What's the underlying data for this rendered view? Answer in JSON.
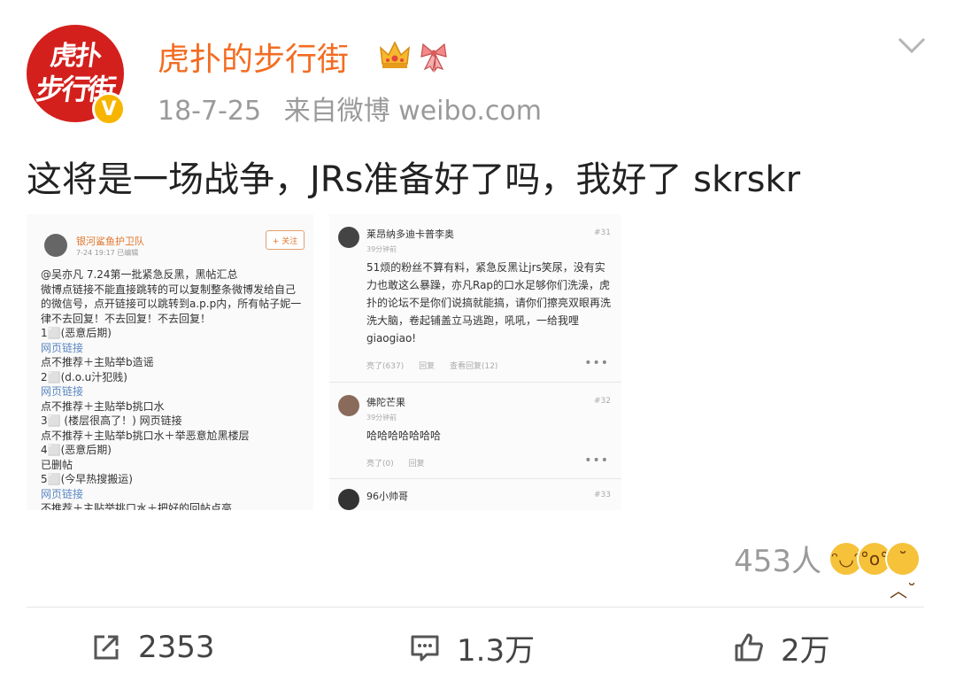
{
  "user": {
    "name": "虎扑的步行街",
    "avatar_line1": "虎扑",
    "avatar_line2": "步行街",
    "verified_label": "V",
    "icons": [
      "crown-icon",
      "ribbon-icon"
    ]
  },
  "post": {
    "date": "18-7-25",
    "source": "来自微博 weibo.com",
    "text": "这将是一场战争，JRs准备好了吗，我好了 skrskr"
  },
  "image1": {
    "user": "银河鲨鱼护卫队",
    "date": "7-24 19:17 已编辑",
    "follow": "+ 关注",
    "lines": [
      {
        "text": "@吴亦凡 7.24第一批紧急反黑，黑帖汇总",
        "link": false
      },
      {
        "text": "微博点链接不能直接跳转的可以复制整条微博发给自己",
        "link": false
      },
      {
        "text": "的微信号，点开链接可以跳转到a.p.p内，所有帖子妮一",
        "link": false
      },
      {
        "text": "律不去回复！不去回复！不去回复！",
        "link": false
      },
      {
        "text": "1⬜(恶意后期)",
        "link": false
      },
      {
        "text": "网页链接",
        "link": true
      },
      {
        "text": " 点不推荐＋主贴举b造谣",
        "link": false
      },
      {
        "text": "2⬜(d.o.u汁犯贱)",
        "link": false
      },
      {
        "text": "网页链接",
        "link": true
      },
      {
        "text": " 点不推荐＋主贴举b挑口水",
        "link": false
      },
      {
        "text": "3⬜ (楼层很高了！) 网页链接",
        "link": false
      },
      {
        "text": "点不推荐＋主贴举b挑口水＋举恶意尬黑楼层",
        "link": false
      },
      {
        "text": "4⬜(恶意后期)",
        "link": false
      },
      {
        "text": "已删帖",
        "link": false
      },
      {
        "text": "5⬜(今早热搜搬运)",
        "link": false
      },
      {
        "text": "网页链接",
        "link": true
      },
      {
        "text": "不推荐＋主贴举挑口水＋把好的回帖点亮",
        "link": false
      }
    ]
  },
  "image2": {
    "comments": [
      {
        "name": "莱昂纳多迪卡普李奥",
        "floor": "#31",
        "time": "39分钟前",
        "text": "51烦的粉丝不算有料，紧急反黑让jrs笑尿，没有实力也敢这么暴躁，亦凡Rap的口水足够你们洗澡，虎扑的论坛不是你们说搞就能搞，请你们擦亮双眼再洗洗大脑，卷起铺盖立马逃跑，吼吼，一给我哩giaogiao!",
        "likes": "亮了(637)",
        "reply": "回复",
        "view": "查看回复(12)"
      },
      {
        "name": "佛陀芒果",
        "floor": "#32",
        "time": "39分钟前",
        "text": "哈哈哈哈哈哈哈",
        "likes": "亮了(0)",
        "reply": "回复",
        "view": ""
      },
      {
        "name": "96小帅哥",
        "floor": "#33",
        "time": "",
        "text": "",
        "likes": "",
        "reply": "",
        "view": ""
      }
    ]
  },
  "reactions": {
    "count": "453人",
    "emojis": [
      "laugh-emoji",
      "surprise-emoji",
      "sad-emoji"
    ]
  },
  "actions": {
    "repost": "2353",
    "comment": "1.3万",
    "like": "2万"
  },
  "colors": {
    "name": "#f36c21",
    "avatar": "#d3201d",
    "verified": "#f7b500",
    "meta": "#9a9a9a"
  }
}
